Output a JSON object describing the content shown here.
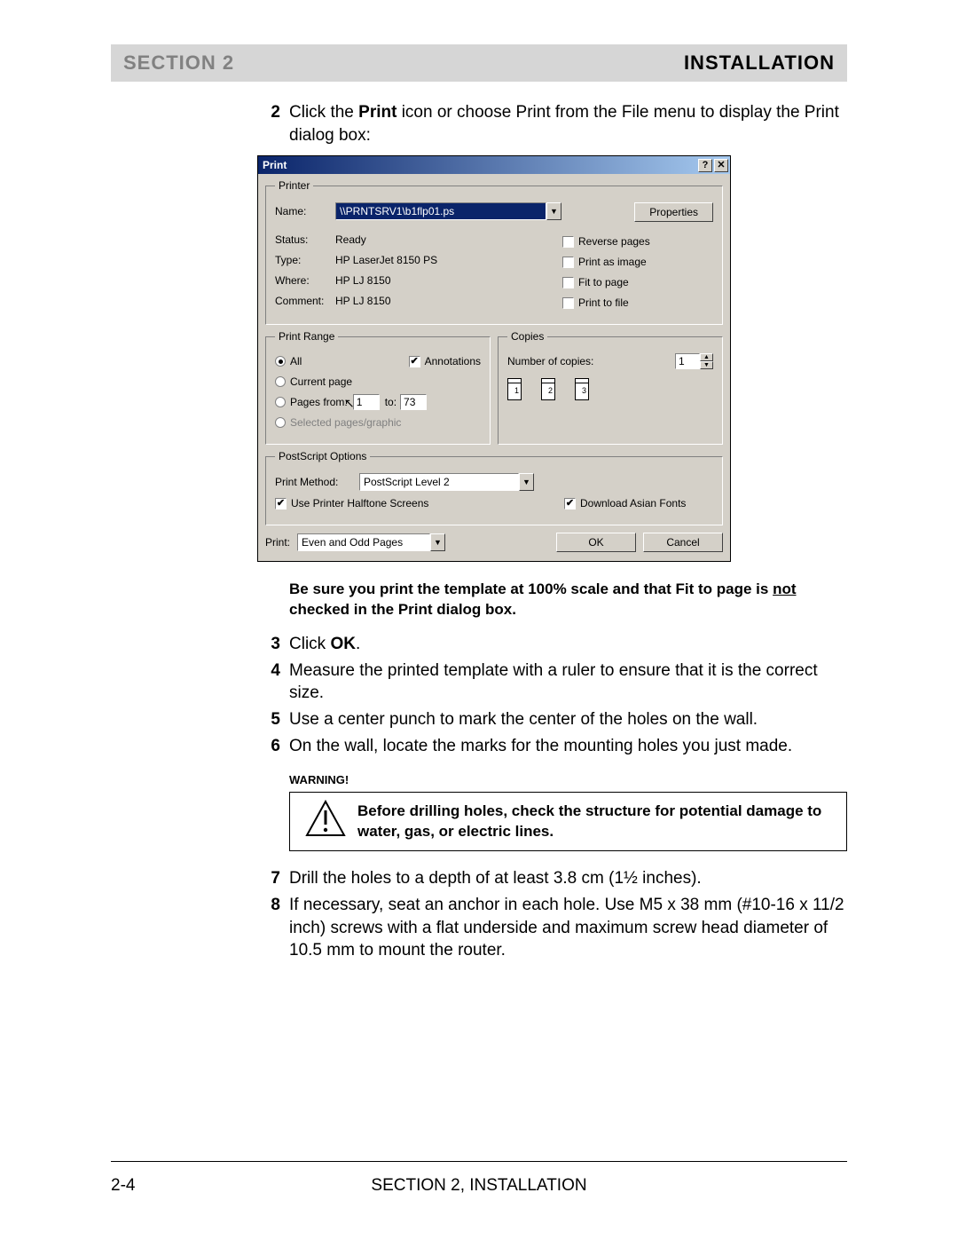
{
  "header": {
    "left": "SECTION 2",
    "right": "INSTALLATION"
  },
  "steps_a": [
    {
      "num": "2",
      "text_pre": "Click the ",
      "bold1": "Print",
      "text_post": " icon or choose Print from the File menu to display the Print dialog box:"
    }
  ],
  "note": {
    "line": "Be sure you print the template at 100% scale and that Fit to page is ",
    "underlined": "not ",
    "tail": "checked in the Print dialog box."
  },
  "steps_b": [
    {
      "num": "3",
      "text_pre": "Click ",
      "bold1": "OK",
      "text_post": "."
    },
    {
      "num": "4",
      "text": "Measure the printed template with a ruler to ensure that it is the correct size."
    },
    {
      "num": "5",
      "text": "Use a center punch to mark the center of the holes on the wall."
    },
    {
      "num": "6",
      "text": "On the wall, locate the marks for the mounting holes you just made."
    }
  ],
  "warning": {
    "label": "WARNING!",
    "text": "Before drilling holes, check the structure for potential damage to water, gas, or electric lines."
  },
  "steps_c": [
    {
      "num": "7",
      "text": "Drill the holes to a depth of at least 3.8 cm (1½ inches)."
    },
    {
      "num": "8",
      "text": "If necessary, seat an anchor in each hole. Use M5 x 38 mm (#10-16 x 11/2 inch) screws with a flat underside and maximum screw head diameter of 10.5 mm to mount the router."
    }
  ],
  "footer": {
    "page": "2-4",
    "title": "SECTION 2, INSTALLATION"
  },
  "dialog": {
    "title": "Print",
    "help": "?",
    "close": "✕",
    "printer": {
      "legend": "Printer",
      "name_lbl": "Name:",
      "name_val": "\\\\PRNTSRV1\\b1flp01.ps",
      "properties": "Properties",
      "status_lbl": "Status:",
      "status_val": "Ready",
      "type_lbl": "Type:",
      "type_val": "HP LaserJet 8150 PS",
      "where_lbl": "Where:",
      "where_val": "HP LJ 8150",
      "comment_lbl": "Comment:",
      "comment_val": "HP LJ 8150",
      "reverse": "Reverse pages",
      "asimage": "Print as image",
      "fit": "Fit to page",
      "tofile": "Print to file"
    },
    "range": {
      "legend": "Print Range",
      "all": "All",
      "annotations": "Annotations",
      "current": "Current page",
      "pages_from": "Pages from:",
      "from_val": "1",
      "to_lbl": "to:",
      "to_val": "73",
      "selected": "Selected pages/graphic"
    },
    "copies": {
      "legend": "Copies",
      "num_lbl": "Number of copies:",
      "num_val": "1",
      "c1": "1",
      "c2": "2",
      "c3": "3"
    },
    "ps": {
      "legend": "PostScript Options",
      "method_lbl": "Print Method:",
      "method_val": "PostScript Level 2",
      "halftone": "Use Printer Halftone Screens",
      "asian": "Download Asian Fonts"
    },
    "bottom": {
      "print_lbl": "Print:",
      "print_val": "Even and Odd Pages",
      "ok": "OK",
      "cancel": "Cancel"
    }
  }
}
